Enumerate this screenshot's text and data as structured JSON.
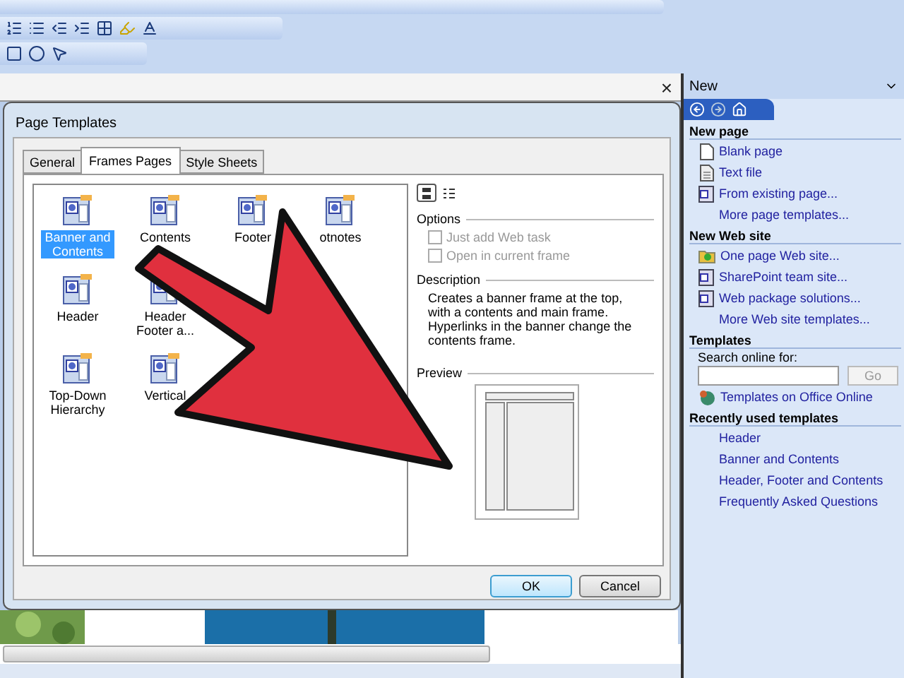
{
  "document_bar": {
    "close": "×"
  },
  "dialog": {
    "title": "Page Templates",
    "tabs": [
      {
        "label": "General",
        "selected": false
      },
      {
        "label": "Frames Pages",
        "selected": true
      },
      {
        "label": "Style Sheets",
        "selected": false
      }
    ],
    "template_rows": [
      [
        {
          "label": "Banner and Contents",
          "selected": true
        },
        {
          "label": "Contents",
          "selected": false
        },
        {
          "label": "Footer",
          "selected": false
        },
        {
          "label": "otnotes",
          "selected": false
        }
      ],
      [
        {
          "label": "Header",
          "selected": false
        },
        {
          "label": "Header Footer a...",
          "selected": false
        }
      ],
      [
        {
          "label": "Top-Down Hierarchy",
          "selected": false
        },
        {
          "label": "Vertical",
          "selected": false
        }
      ]
    ],
    "view_modes": [
      {
        "kind": "large",
        "selected": true
      },
      {
        "kind": "list",
        "selected": false
      }
    ],
    "options": {
      "heading": "Options",
      "items": [
        {
          "label": "Just add Web task",
          "checked": false,
          "disabled": true
        },
        {
          "label": "Open in current frame",
          "checked": false,
          "disabled": true
        }
      ]
    },
    "description": {
      "heading": "Description",
      "text": "Creates a banner frame at the top, with a contents and main frame. Hyperlinks in the banner change the contents frame."
    },
    "preview": {
      "heading": "Preview"
    },
    "buttons": [
      {
        "label": "OK",
        "focused": true
      },
      {
        "label": "Cancel",
        "focused": false
      }
    ]
  },
  "task_pane": {
    "title": "New",
    "sections": [
      {
        "heading": "New page",
        "items": [
          {
            "label": "Blank page",
            "kind": "blank"
          },
          {
            "label": "Text file",
            "kind": "text"
          },
          {
            "label": "From existing page...",
            "kind": "page"
          },
          {
            "label": "More page templates...",
            "kind": "plain"
          }
        ]
      },
      {
        "heading": "New Web site",
        "items": [
          {
            "label": "One page Web site...",
            "kind": "folder"
          },
          {
            "label": "SharePoint team site...",
            "kind": "page"
          },
          {
            "label": "Web package solutions...",
            "kind": "page"
          },
          {
            "label": "More Web site templates...",
            "kind": "plain"
          }
        ]
      },
      {
        "heading": "Templates",
        "search_label": "Search online for:",
        "go": "Go",
        "items": [
          {
            "label": "Templates on Office Online",
            "kind": "globe"
          }
        ]
      },
      {
        "heading": "Recently used templates",
        "items": [
          {
            "label": "Header",
            "kind": "plain"
          },
          {
            "label": "Banner and Contents",
            "kind": "plain"
          },
          {
            "label": "Header, Footer and Contents",
            "kind": "plain"
          },
          {
            "label": "Frequently Asked Questions",
            "kind": "plain"
          }
        ]
      }
    ]
  }
}
